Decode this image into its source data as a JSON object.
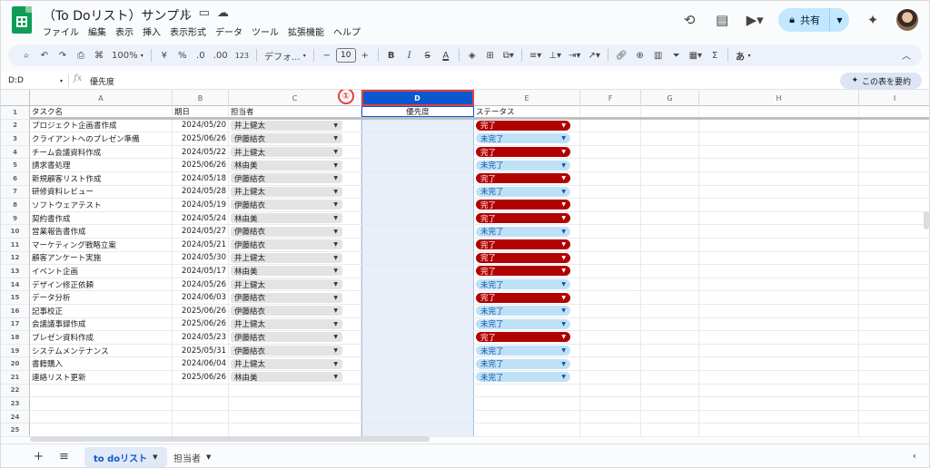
{
  "app": {
    "doc_title": "（To Doリスト）サンプル",
    "menus": [
      "ファイル",
      "編集",
      "表示",
      "挿入",
      "表示形式",
      "データ",
      "ツール",
      "拡張機能",
      "ヘルプ"
    ],
    "share_label": "共有",
    "colors": {
      "accent": "#0b57d0",
      "done": "#b10202",
      "todo": "#bfe1f6",
      "marker": "#e0403f"
    }
  },
  "toolbar": {
    "zoom": "100%",
    "currency": "¥",
    "percent": "%",
    "dec_decrease": ".0",
    "dec_increase": ".00",
    "number_format": "123",
    "font": "デフォ...",
    "font_size": "10",
    "minus": "−",
    "plus": "+",
    "bold": "B",
    "italic": "I",
    "strike": "S",
    "text_color": "A",
    "sum": "Σ",
    "input_tool": "あ"
  },
  "formula_bar": {
    "name_box": "D:D",
    "fx": "fx",
    "content": "優先度",
    "summary_button": "この表を要約"
  },
  "grid": {
    "columns": [
      "A",
      "B",
      "C",
      "D",
      "E",
      "F",
      "G",
      "H",
      "I"
    ],
    "row_numbers": [
      "1",
      "2",
      "3",
      "4",
      "5",
      "6",
      "7",
      "8",
      "9",
      "10",
      "11",
      "12",
      "13",
      "14",
      "15",
      "16",
      "17",
      "18",
      "19",
      "20",
      "21",
      "22",
      "23",
      "24",
      "25"
    ],
    "header": {
      "task": "タスク名",
      "date": "期日",
      "owner": "担当者",
      "priority": "優先度",
      "status": "ステータス"
    },
    "marker": "①",
    "rows": [
      {
        "task": "プロジェクト企画書作成",
        "date": "2024/05/20",
        "owner": "井上健太",
        "status": "完了"
      },
      {
        "task": "クライアントへのプレゼン準備",
        "date": "2025/06/26",
        "owner": "伊藤結衣",
        "status": "未完了"
      },
      {
        "task": "チーム会議資料作成",
        "date": "2024/05/22",
        "owner": "井上健太",
        "status": "完了"
      },
      {
        "task": "請求書処理",
        "date": "2025/06/26",
        "owner": "林由美",
        "status": "未完了"
      },
      {
        "task": "新規顧客リスト作成",
        "date": "2024/05/18",
        "owner": "伊藤結衣",
        "status": "完了"
      },
      {
        "task": "研修資料レビュー",
        "date": "2024/05/28",
        "owner": "井上健太",
        "status": "未完了"
      },
      {
        "task": "ソフトウェアテスト",
        "date": "2024/05/19",
        "owner": "伊藤結衣",
        "status": "完了"
      },
      {
        "task": "契約書作成",
        "date": "2024/05/24",
        "owner": "林由美",
        "status": "完了"
      },
      {
        "task": "営業報告書作成",
        "date": "2024/05/27",
        "owner": "伊藤結衣",
        "status": "未完了"
      },
      {
        "task": "マーケティング戦略立案",
        "date": "2024/05/21",
        "owner": "伊藤結衣",
        "status": "完了"
      },
      {
        "task": "顧客アンケート実施",
        "date": "2024/05/30",
        "owner": "井上健太",
        "status": "完了"
      },
      {
        "task": "イベント企画",
        "date": "2024/05/17",
        "owner": "林由美",
        "status": "完了"
      },
      {
        "task": "デザイン修正依頼",
        "date": "2024/05/26",
        "owner": "井上健太",
        "status": "未完了"
      },
      {
        "task": "データ分析",
        "date": "2024/06/03",
        "owner": "伊藤結衣",
        "status": "完了"
      },
      {
        "task": "記事校正",
        "date": "2025/06/26",
        "owner": "伊藤結衣",
        "status": "未完了"
      },
      {
        "task": "会議議事録作成",
        "date": "2025/06/26",
        "owner": "井上健太",
        "status": "未完了"
      },
      {
        "task": "プレゼン資料作成",
        "date": "2024/05/23",
        "owner": "伊藤結衣",
        "status": "完了"
      },
      {
        "task": "システムメンテナンス",
        "date": "2025/05/31",
        "owner": "伊藤結衣",
        "status": "未完了"
      },
      {
        "task": "書籍購入",
        "date": "2024/06/04",
        "owner": "井上健太",
        "status": "未完了"
      },
      {
        "task": "連絡リスト更新",
        "date": "2025/06/26",
        "owner": "林由美",
        "status": "未完了"
      }
    ]
  },
  "tabs": [
    {
      "label": "to doリスト",
      "active": true
    },
    {
      "label": "担当者",
      "active": false
    }
  ]
}
